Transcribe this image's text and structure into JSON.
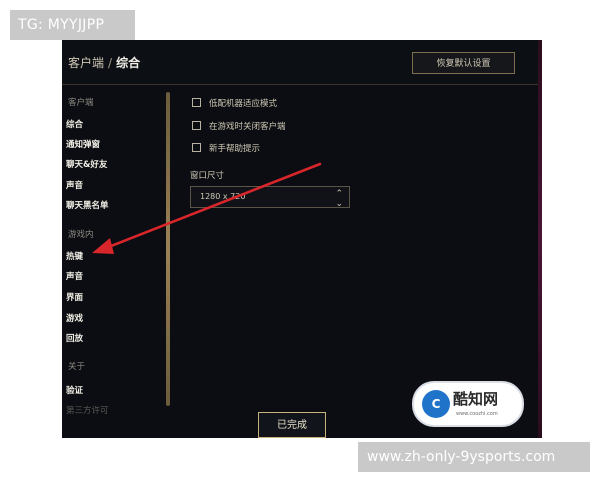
{
  "watermark": {
    "top_left": "TG: MYYJJPP",
    "bottom_right": "www.zh-only-9ysports.com",
    "logo": {
      "mark": "C",
      "name": "酷知网",
      "sub": "www.coozhi.com"
    }
  },
  "header": {
    "breadcrumb_root": "客户端",
    "breadcrumb_sep": "/",
    "breadcrumb_current": "综合",
    "restore_button": "恢复默认设置"
  },
  "sidebar": {
    "client_section": "客户端",
    "client_items": [
      "综合",
      "通知弹窗",
      "聊天&好友",
      "声音",
      "聊天黑名单"
    ],
    "ingame_section": "游戏内",
    "ingame_items": [
      "热键",
      "声音",
      "界面",
      "游戏",
      "回放"
    ],
    "about_section": "关于",
    "about_items": [
      "验证",
      "第三方许可"
    ]
  },
  "options": [
    {
      "label": "低配机器适应模式",
      "checked": false
    },
    {
      "label": "在游戏时关闭客户端",
      "checked": false
    },
    {
      "label": "新手帮助提示",
      "checked": false
    }
  ],
  "window_size": {
    "label": "窗口尺寸",
    "value": "1280 x 720"
  },
  "footer": {
    "done_button": "已完成"
  },
  "colors": {
    "accent_gold": "#c8b37a",
    "background": "#0b0d12",
    "arrow": "#d8262a"
  }
}
